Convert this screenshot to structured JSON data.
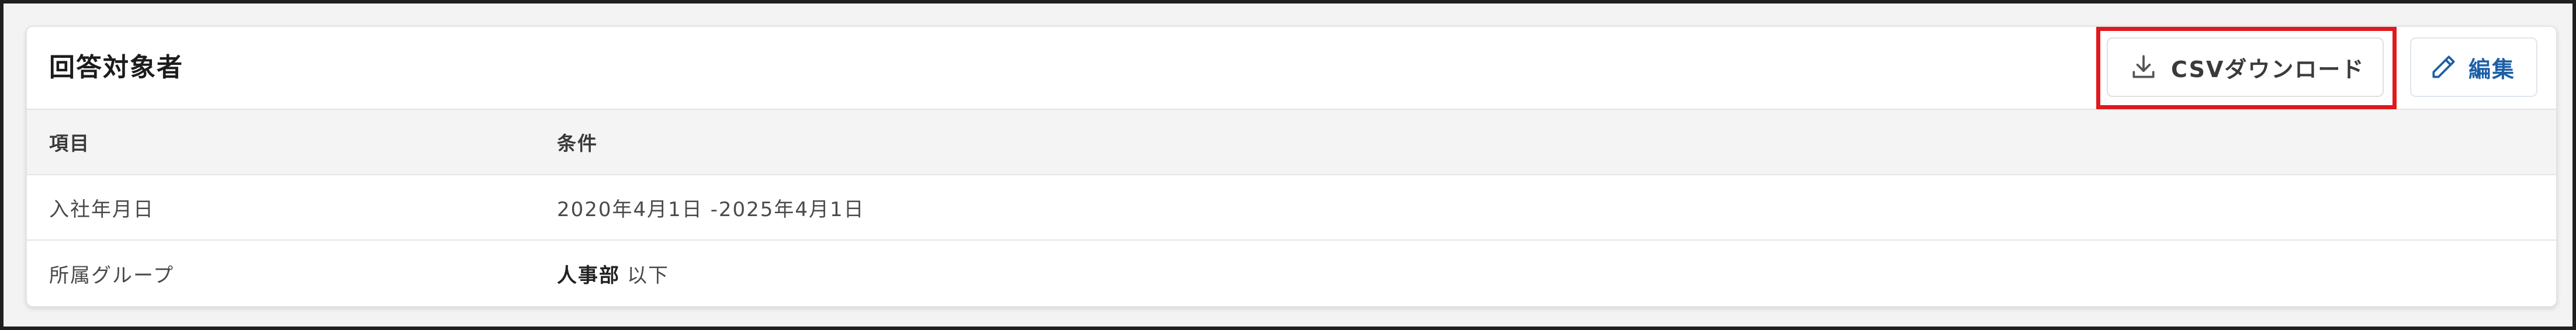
{
  "card": {
    "title": "回答対象者",
    "buttons": {
      "csv_download": {
        "label": "CSVダウンロード",
        "icon": "download-icon"
      },
      "edit": {
        "label": "編集",
        "icon": "pencil-icon"
      }
    }
  },
  "table": {
    "headers": [
      "項目",
      "条件"
    ],
    "rows": [
      {
        "item": "入社年月日",
        "condition": "2020年4月1日 -2025年4月1日"
      },
      {
        "item": "所属グループ",
        "condition_strong": "人事部",
        "condition_suffix": "以下"
      }
    ]
  },
  "colors": {
    "highlight_box": "#e0191e",
    "edit_accent": "#1d5fa8"
  }
}
